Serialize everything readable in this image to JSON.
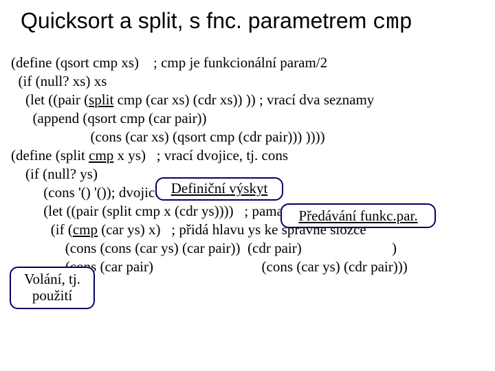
{
  "title_a": "Quicksort a split, s fnc. parametrem ",
  "title_b": "cmp",
  "code_lines": [
    "(define (qsort cmp xs)    ; cmp je funkcionální param/2",
    "  (if (null? xs) xs",
    "    (let ((pair (",
    "split",
    " cmp (car xs) (cdr xs)) )) ; vrací dva seznamy",
    "      (append (qsort cmp (car pair))",
    "                      (cons (car xs) (qsort cmp (cdr pair))) ))))",
    "(define (split ",
    "cmp",
    " x ys)   ; vrací dvojice, tj. cons",
    "    (if (null? ys)",
    "         (cons '() '()); dvojice prázdných",
    "         (let ((pair (split cmp x (cdr ys))))   ; pamatuje si dvojici z rek.",
    "           (if (",
    "cmp",
    " (car ys) x)   ; přidá hlavu ys ke správné složce",
    "               (cons (cons (car ys) (car pair))  (cdr pair)                         )",
    "               (cons (car pair)                              (cons (car ys) (cdr pair)))",
    ")   )    )  )"
  ],
  "callouts": {
    "c1": "Definiční výskyt",
    "c2": "Předávání funkc.par.",
    "c3a": "Volání, tj.",
    "c3b": "použití"
  }
}
